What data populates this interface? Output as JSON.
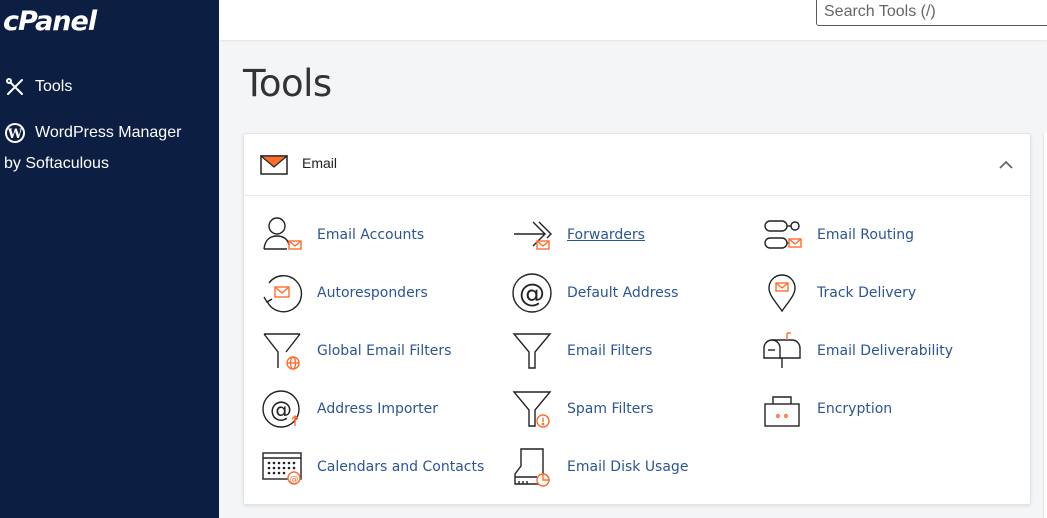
{
  "sidebar": {
    "logo": "cPanel",
    "items": [
      {
        "label": "Tools"
      },
      {
        "label": "WordPress Manager"
      }
    ],
    "wp_sub": "by Softaculous"
  },
  "header": {
    "search_placeholder": "Search Tools (/)"
  },
  "page": {
    "title": "Tools"
  },
  "email_panel": {
    "title": "Email",
    "items": [
      {
        "label": "Email Accounts",
        "icon": "email-accounts-icon"
      },
      {
        "label": "Forwarders",
        "icon": "forwarders-icon"
      },
      {
        "label": "Email Routing",
        "icon": "email-routing-icon"
      },
      {
        "label": "Autoresponders",
        "icon": "autoresponders-icon"
      },
      {
        "label": "Default Address",
        "icon": "default-address-icon"
      },
      {
        "label": "Track Delivery",
        "icon": "track-delivery-icon"
      },
      {
        "label": "Global Email Filters",
        "icon": "global-email-filters-icon"
      },
      {
        "label": "Email Filters",
        "icon": "email-filters-icon"
      },
      {
        "label": "Email Deliverability",
        "icon": "email-deliverability-icon"
      },
      {
        "label": "Address Importer",
        "icon": "address-importer-icon"
      },
      {
        "label": "Spam Filters",
        "icon": "spam-filters-icon"
      },
      {
        "label": "Encryption",
        "icon": "encryption-icon"
      },
      {
        "label": "Calendars and Contacts",
        "icon": "calendars-contacts-icon"
      },
      {
        "label": "Email Disk Usage",
        "icon": "email-disk-usage-icon"
      }
    ]
  },
  "colors": {
    "sidebar_bg": "#0d1e43",
    "link": "#2b5597",
    "accent_orange": "#ff6c2c"
  }
}
